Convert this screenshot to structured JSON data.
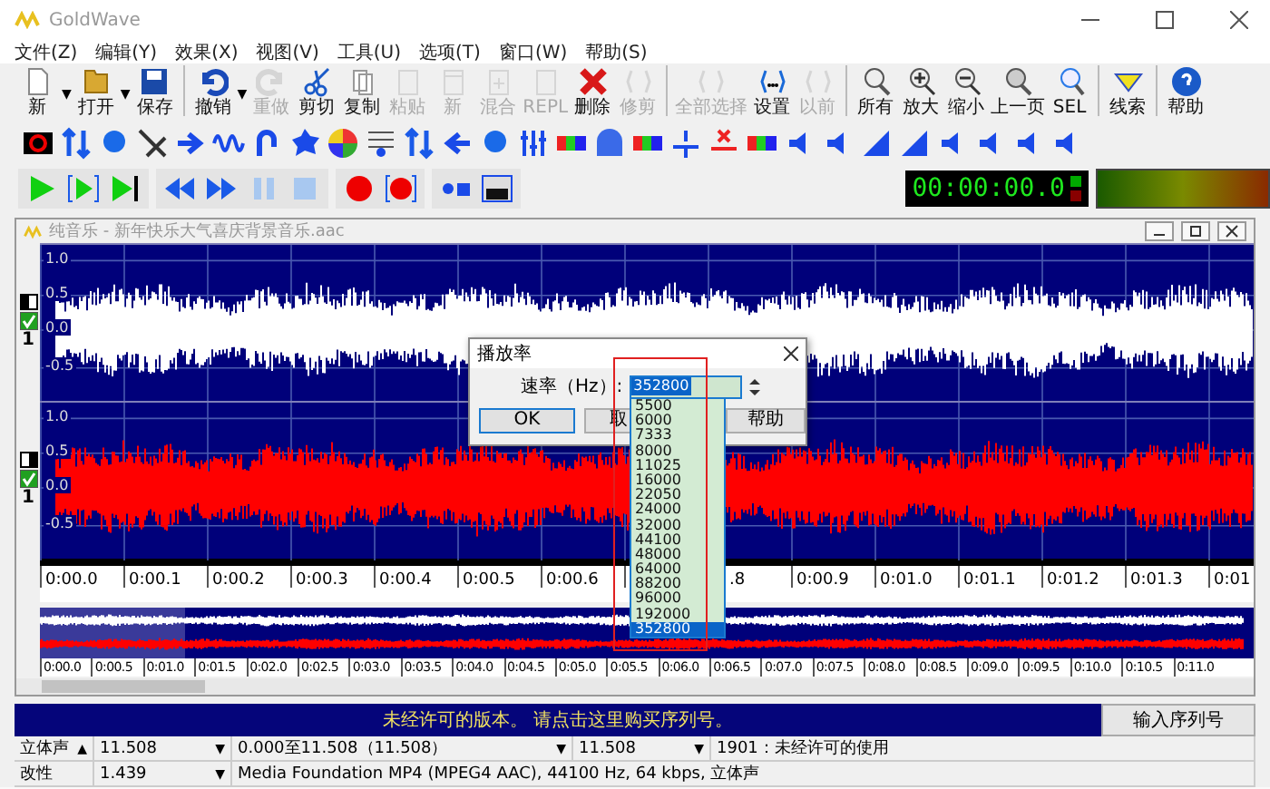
{
  "window": {
    "title": "GoldWave"
  },
  "menu": [
    "文件(Z)",
    "编辑(Y)",
    "效果(X)",
    "视图(V)",
    "工具(U)",
    "选项(T)",
    "窗口(W)",
    "帮助(S)"
  ],
  "toolbar": [
    {
      "label": "新",
      "disabled": false,
      "dropdown": true
    },
    {
      "label": "打开",
      "disabled": false,
      "dropdown": true
    },
    {
      "label": "保存",
      "disabled": false,
      "separator": true
    },
    {
      "label": "撤销",
      "disabled": false,
      "dropdown": true
    },
    {
      "label": "重做",
      "disabled": true
    },
    {
      "label": "剪切",
      "disabled": false
    },
    {
      "label": "复制",
      "disabled": false
    },
    {
      "label": "粘贴",
      "disabled": true
    },
    {
      "label": "新",
      "disabled": true
    },
    {
      "label": "混合",
      "disabled": true
    },
    {
      "label": "REPL",
      "disabled": true
    },
    {
      "label": "删除",
      "disabled": false
    },
    {
      "label": "修剪",
      "disabled": true,
      "separator": true
    },
    {
      "label": "全部选择",
      "disabled": true
    },
    {
      "label": "设置",
      "disabled": false
    },
    {
      "label": "以前",
      "disabled": true,
      "separator": true
    },
    {
      "label": "所有",
      "disabled": false
    },
    {
      "label": "放大",
      "disabled": false
    },
    {
      "label": "缩小",
      "disabled": false
    },
    {
      "label": "上一页",
      "disabled": false
    },
    {
      "label": "SEL",
      "disabled": false,
      "separator": true
    },
    {
      "label": "线索",
      "disabled": false,
      "separator": true
    },
    {
      "label": "帮助",
      "disabled": false
    }
  ],
  "time_display": "00:00:00.0",
  "document": {
    "title": "纯音乐 - 新年快乐大气喜庆背景音乐.aac",
    "channels": [
      {
        "number": "1",
        "enabled": true,
        "color": "#ffffff",
        "scale": [
          "1.0",
          "0.5",
          "0.0",
          "-0.5"
        ]
      },
      {
        "number": "1",
        "enabled": true,
        "color": "#ff0000",
        "scale": [
          "1.0",
          "0.5",
          "0.0",
          "-0.5"
        ]
      }
    ],
    "ruler": [
      {
        "label": "0:00.0",
        "partial": false
      },
      {
        "label": "0:00.1",
        "partial": false
      },
      {
        "label": "0:00.2",
        "partial": false
      },
      {
        "label": "0:00.3",
        "partial": false
      },
      {
        "label": "0:00.4",
        "partial": false
      },
      {
        "label": "0:00.5",
        "partial": false
      },
      {
        "label": "0:00.6",
        "partial": false
      },
      {
        "label": ".8",
        "partial": true
      },
      {
        "label": "0:00.9",
        "partial": false
      },
      {
        "label": "0:01.0",
        "partial": false
      },
      {
        "label": "0:01.1",
        "partial": false
      },
      {
        "label": "0:01.2",
        "partial": false
      },
      {
        "label": "0:01.3",
        "partial": false
      },
      {
        "label": "0:01",
        "partial": false
      }
    ],
    "overview_ruler": [
      "0:00.0",
      "0:00.5",
      "0:01.0",
      "0:01.5",
      "0:02.0",
      "0:02.5",
      "0:03.0",
      "0:03.5",
      "0:04.0",
      "0:04.5",
      "0:05.0",
      "0:05.5",
      "0:06.0",
      "0:06.5",
      "0:07.0",
      "0:07.5",
      "0:08.0",
      "0:08.5",
      "0:09.0",
      "0:09.5",
      "0:10.0",
      "0:10.5",
      "0:11.0"
    ]
  },
  "dialog": {
    "title": "播放率",
    "field_label": "速率（Hz）:",
    "value": "352800",
    "buttons": [
      "OK",
      "取",
      "帮助"
    ],
    "options": [
      {
        "label": "5500",
        "selected": false
      },
      {
        "label": "6000",
        "selected": false
      },
      {
        "label": "7333",
        "selected": false
      },
      {
        "label": "8000",
        "selected": false
      },
      {
        "label": "11025",
        "selected": false
      },
      {
        "label": "16000",
        "selected": false
      },
      {
        "label": "22050",
        "selected": false
      },
      {
        "label": "24000",
        "selected": false
      },
      {
        "label": "32000",
        "selected": false
      },
      {
        "label": "44100",
        "selected": false
      },
      {
        "label": "48000",
        "selected": false
      },
      {
        "label": "64000",
        "selected": false
      },
      {
        "label": "88200",
        "selected": false
      },
      {
        "label": "96000",
        "selected": false
      },
      {
        "label": "192000",
        "selected": false
      },
      {
        "label": "352800",
        "selected": true
      }
    ]
  },
  "banner": {
    "text": "未经许可的版本。 请点击这里购买序列号。",
    "button": "输入序列号"
  },
  "status_rows": [
    [
      {
        "text": "立体声",
        "arrow": "▲"
      },
      {
        "text": "11.508",
        "arrow": "▼"
      },
      {
        "text": "0.000至11.508（11.508）",
        "arrow": "▼"
      },
      {
        "text": "11.508",
        "arrow": "▼"
      },
      {
        "text": "1901：未经许可的使用"
      }
    ],
    [
      {
        "text": "改性"
      },
      {
        "text": "1.439",
        "arrow": "▼"
      },
      {
        "text": "Media Foundation MP4 (MPEG4 AAC), 44100 Hz, 64 kbps, 立体声"
      }
    ]
  ]
}
